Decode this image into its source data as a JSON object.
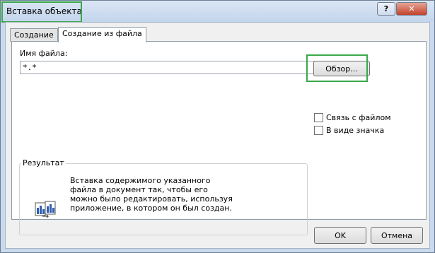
{
  "window": {
    "title": "Вставка объекта",
    "help_label": "?",
    "close_label": "✕"
  },
  "tabs": [
    {
      "label": "Создание"
    },
    {
      "label": "Создание из файла"
    }
  ],
  "file": {
    "label": "Имя файла:",
    "value": "*.*",
    "browse_label": "Обзор..."
  },
  "options": {
    "link_label": "Связь с файлом",
    "link_checked": false,
    "icon_label": "В виде значка",
    "icon_checked": false
  },
  "result": {
    "title": "Результат",
    "text": "Вставка содержимого указанного файла в документ так, чтобы его можно было редактировать, используя приложение, в котором он был создан.",
    "icon": "insert-file-icon"
  },
  "buttons": {
    "ok": "OK",
    "cancel": "Отмена"
  },
  "colors": {
    "highlight": "#3aa84a",
    "title_bg": "#c9d9ee",
    "close_bg": "#c3412a"
  }
}
